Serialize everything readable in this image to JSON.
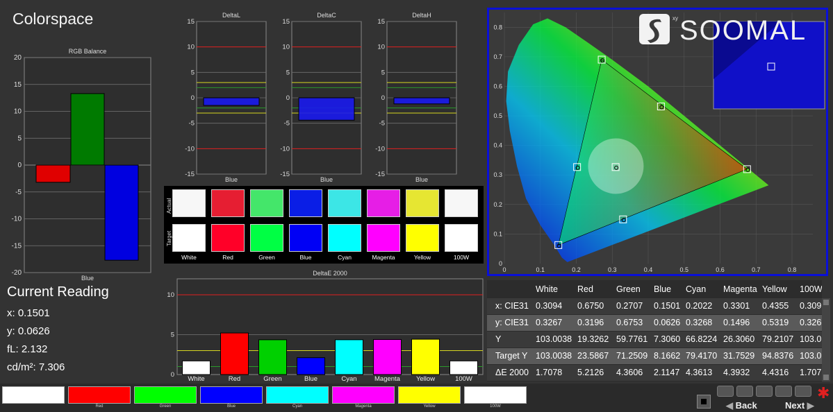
{
  "window": {
    "title": "Colorspace"
  },
  "rgb_balance": {
    "title": "RGB Balance",
    "xlabel": "Blue",
    "ylim": [
      -20,
      20
    ],
    "ticks": [
      "20",
      "15",
      "10",
      "5",
      "0",
      "-5",
      "-10",
      "-15",
      "-20"
    ],
    "bars": [
      {
        "name": "red",
        "value": -3.2,
        "color": "#e00000"
      },
      {
        "name": "green",
        "value": 13.3,
        "color": "#007a00"
      },
      {
        "name": "blue",
        "value": -17.7,
        "color": "#0000e0"
      }
    ]
  },
  "delta_charts": [
    {
      "title": "DeltaL",
      "xlabel": "Blue",
      "value": -1.5
    },
    {
      "title": "DeltaC",
      "xlabel": "Blue",
      "value": -4.4
    },
    {
      "title": "DeltaH",
      "xlabel": "Blue",
      "value": -1.2
    }
  ],
  "delta_ticks": [
    "15",
    "10",
    "5",
    "0",
    "-5",
    "-10",
    "-15"
  ],
  "patches": {
    "row_actual": "Actual",
    "row_target": "Target",
    "items": [
      {
        "label": "White",
        "actual": "#f7f7f7",
        "target": "#ffffff"
      },
      {
        "label": "Red",
        "actual": "#e61e32",
        "target": "#ff0028"
      },
      {
        "label": "Green",
        "actual": "#44e66a",
        "target": "#00ff44"
      },
      {
        "label": "Blue",
        "actual": "#0a1ee6",
        "target": "#0000f5"
      },
      {
        "label": "Cyan",
        "actual": "#3ce6e6",
        "target": "#00ffff"
      },
      {
        "label": "Magenta",
        "actual": "#e61ee6",
        "target": "#ff00ff"
      },
      {
        "label": "Yellow",
        "actual": "#e6e632",
        "target": "#ffff00"
      },
      {
        "label": "100W",
        "actual": "#f7f7f7",
        "target": "#ffffff"
      }
    ]
  },
  "deltae": {
    "title": "DeltaE 2000",
    "ylim": [
      0,
      12
    ],
    "ticks": [
      "10",
      "5",
      "0"
    ],
    "categories": [
      "White",
      "Red",
      "Green",
      "Blue",
      "Cyan",
      "Magenta",
      "Yellow",
      "100W"
    ],
    "values": [
      1.7078,
      5.2126,
      4.3606,
      2.1147,
      4.3613,
      4.3932,
      4.4316,
      1.7078
    ],
    "colors": [
      "#ffffff",
      "#ff0000",
      "#00d000",
      "#0000ff",
      "#00ffff",
      "#ff00ff",
      "#ffff00",
      "#ffffff"
    ]
  },
  "current_reading": {
    "title": "Current Reading",
    "x": "x: 0.1501",
    "y": "y: 0.0626",
    "fl": "fL: 2.132",
    "cdm2": "cd/m²: 7.306"
  },
  "cie": {
    "title": "xy",
    "xticks": [
      "0",
      "0.1",
      "0.2",
      "0.3",
      "0.4",
      "0.5",
      "0.6",
      "0.7",
      "0.8"
    ],
    "yticks": [
      "0.8",
      "0.7",
      "0.6",
      "0.5",
      "0.4",
      "0.3",
      "0.2",
      "0.1"
    ],
    "targets": [
      {
        "name": "red",
        "x": 0.675,
        "y": 0.3196
      },
      {
        "name": "green",
        "x": 0.2707,
        "y": 0.6903
      },
      {
        "name": "blue",
        "x": 0.1501,
        "y": 0.0626
      },
      {
        "name": "cyan",
        "x": 0.2022,
        "y": 0.3268
      },
      {
        "name": "magenta",
        "x": 0.3301,
        "y": 0.1496
      },
      {
        "name": "yellow",
        "x": 0.4355,
        "y": 0.5319
      },
      {
        "name": "white",
        "x": 0.3094,
        "y": 0.3267
      }
    ]
  },
  "logo": {
    "text": "SOOMAL"
  },
  "table": {
    "headers": [
      "",
      "White",
      "Red",
      "Green",
      "Blue",
      "Cyan",
      "Magenta",
      "Yellow",
      "100W"
    ],
    "rows": [
      [
        "x: CIE31",
        "0.3094",
        "0.6750",
        "0.2707",
        "0.1501",
        "0.2022",
        "0.3301",
        "0.4355",
        "0.309"
      ],
      [
        "y: CIE31",
        "0.3267",
        "0.3196",
        "0.6753",
        "0.0626",
        "0.3268",
        "0.1496",
        "0.5319",
        "0.326"
      ],
      [
        "Y",
        "103.0038",
        "19.3262",
        "59.7761",
        "7.3060",
        "66.8224",
        "26.3060",
        "79.2107",
        "103.0"
      ],
      [
        "Target Y",
        "103.0038",
        "23.5867",
        "71.2509",
        "8.1662",
        "79.4170",
        "31.7529",
        "94.8376",
        "103.0"
      ],
      [
        "ΔE 2000",
        "1.7078",
        "5.2126",
        "4.3606",
        "2.1147",
        "4.3613",
        "4.3932",
        "4.4316",
        "1.707"
      ]
    ]
  },
  "bottom": {
    "swatches": [
      {
        "label": "",
        "color": "#ffffff"
      },
      {
        "label": "Red",
        "color": "#ff0000"
      },
      {
        "label": "Green",
        "color": "#00ff00"
      },
      {
        "label": "Blue",
        "color": "#0000ff"
      },
      {
        "label": "Cyan",
        "color": "#00ffff"
      },
      {
        "label": "Magenta",
        "color": "#ff00ff"
      },
      {
        "label": "Yellow",
        "color": "#ffff00"
      },
      {
        "label": "100W",
        "color": "#ffffff"
      }
    ],
    "back": "Back",
    "next": "Next"
  }
}
